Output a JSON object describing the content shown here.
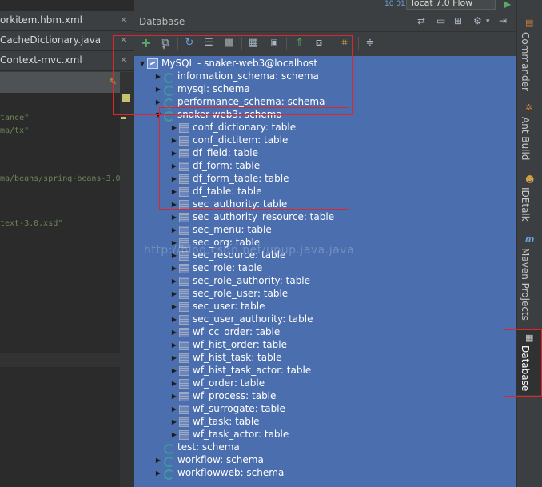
{
  "toolbar": {
    "run_config": "Tocat 7.0 Flow",
    "build_badge": "10 01"
  },
  "editor": {
    "tabs": [
      {
        "label": "orkitem.hbm.xml",
        "close": "×"
      },
      {
        "label": "CacheDictionary.java",
        "close": "×"
      },
      {
        "label": "Context-mvc.xml",
        "close": "×"
      }
    ],
    "code_lines": [
      "tance\"",
      "ma/tx\"",
      "ma/beans/spring-beans-3.0",
      "text-3.0.xsd\""
    ]
  },
  "database": {
    "title": "Database",
    "tree": {
      "root": "MySQL - snaker-web3@localhost",
      "schemas_before": [
        "information_schema: schema",
        "mysql: schema",
        "performance_schema: schema"
      ],
      "open_schema": "snaker-web3: schema",
      "tables": [
        "conf_dictionary: table",
        "conf_dictitem: table",
        "df_field: table",
        "df_form: table",
        "df_form_table: table",
        "df_table: table",
        "sec_authority: table",
        "sec_authority_resource: table",
        "sec_menu: table",
        "sec_org: table",
        "sec_resource: table",
        "sec_role: table",
        "sec_role_authority: table",
        "sec_role_user: table",
        "sec_user: table",
        "sec_user_authority: table",
        "wf_cc_order: table",
        "wf_hist_order: table",
        "wf_hist_task: table",
        "wf_hist_task_actor: table",
        "wf_order: table",
        "wf_process: table",
        "wf_surrogate: table",
        "wf_task: table",
        "wf_task_actor: table"
      ],
      "schemas_after": [
        "test: schema",
        "workflow: schema",
        "workflowweb: schema"
      ]
    },
    "watermark": "http://blog.csdn.net/upup.java.java"
  },
  "right_stripe": {
    "items": [
      "Commander",
      "Ant Build",
      "IDEtalk",
      "Maven Projects",
      "Database"
    ]
  }
}
